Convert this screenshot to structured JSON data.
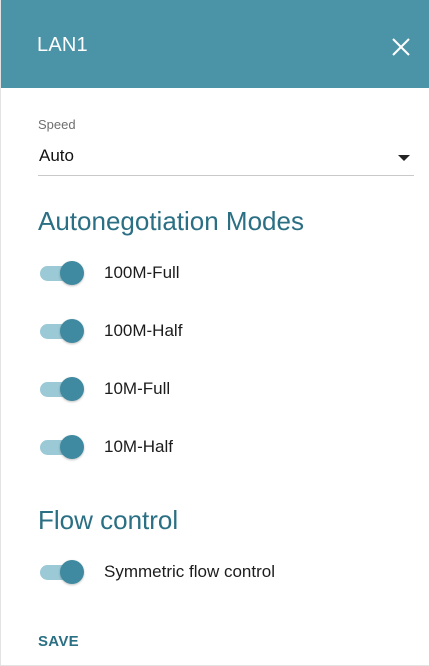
{
  "dialog": {
    "title": "LAN1",
    "close_icon": "close-icon"
  },
  "speed": {
    "label": "Speed",
    "value": "Auto",
    "arrow_icon": "caret-down-icon"
  },
  "autonegotiation": {
    "title": "Autonegotiation Modes",
    "modes": [
      {
        "label": "100M-Full",
        "enabled": true
      },
      {
        "label": "100M-Half",
        "enabled": true
      },
      {
        "label": "10M-Full",
        "enabled": true
      },
      {
        "label": "10M-Half",
        "enabled": true
      }
    ]
  },
  "flow_control": {
    "title": "Flow control",
    "symmetric": {
      "label": "Symmetric flow control",
      "enabled": true
    }
  },
  "actions": {
    "save_label": "SAVE"
  },
  "colors": {
    "header": "#4b93a7",
    "accent": "#2a6f83",
    "toggle_thumb": "#3f8aa0",
    "toggle_track": "#9bc9d6"
  }
}
